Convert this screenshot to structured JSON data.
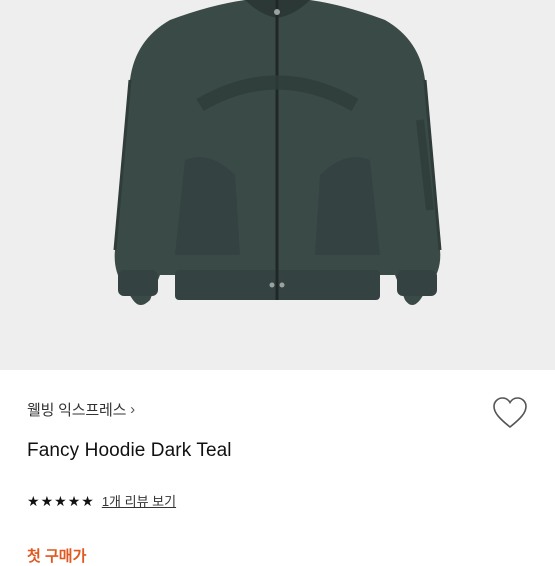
{
  "product": {
    "brand_link": "웰빙 익스프레스",
    "chevron_glyph": "›",
    "name": "Fancy Hoodie Dark Teal",
    "rating_stars": 5,
    "review_link": "1개 리뷰 보기",
    "cut_off_text": "첫 구매가"
  },
  "colors": {
    "hero_bg": "#eeeeee",
    "hoodie": "#3a4a47",
    "accent_orange": "#e0571f"
  }
}
